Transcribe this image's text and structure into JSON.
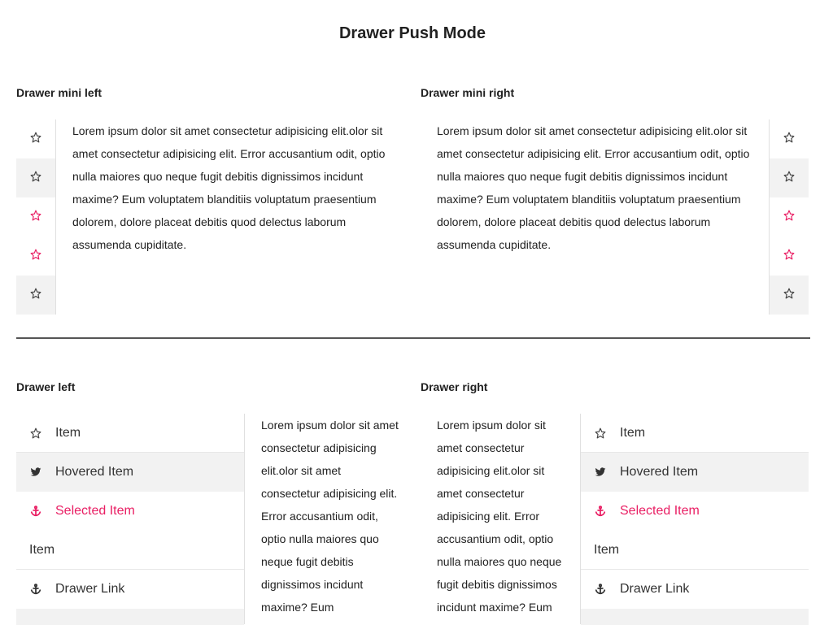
{
  "page": {
    "title": "Drawer Push Mode"
  },
  "sections": {
    "mini_left": "Drawer mini left",
    "mini_right": "Drawer mini right",
    "left": "Drawer left",
    "right": "Drawer right"
  },
  "lorem": "Lorem ipsum dolor sit amet consectetur adipisicing elit.olor sit amet consectetur adipisicing elit. Error accusantium odit, optio nulla maiores quo neque fugit debitis dignissimos incidunt maxime? Eum voluptatem blanditiis voluptatum praesentium dolorem, dolore placeat debitis quod delectus laborum assumenda cupiditate.",
  "lorem_narrow": "Lorem ipsum dolor sit amet consectetur adipisicing elit.olor sit amet consectetur adipisicing elit. Error accusantium odit, optio nulla maiores quo neque fugit debitis dignissimos incidunt maxime? Eum",
  "drawer_items": {
    "item": "Item",
    "hovered": "Hovered Item",
    "selected": "Selected Item",
    "plain": "Item",
    "link": "Drawer Link"
  },
  "colors": {
    "accent": "#e91e63",
    "hover_bg": "#f2f2f2",
    "icon": "#444444"
  },
  "icons": [
    "star-outline-icon",
    "twitter-icon",
    "anchor-icon"
  ]
}
